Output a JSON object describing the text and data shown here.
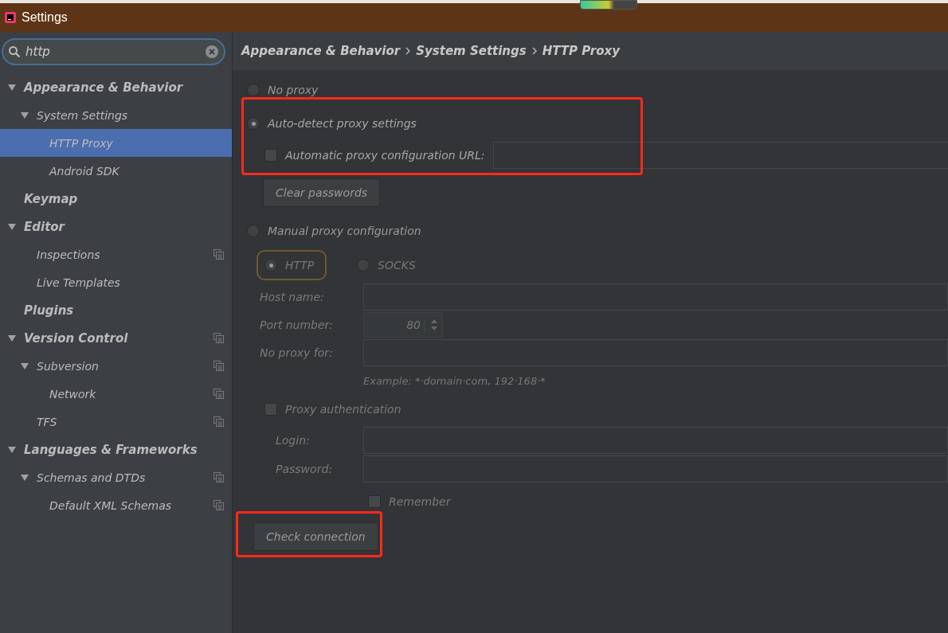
{
  "window": {
    "title": "Settings"
  },
  "search": {
    "value": "http"
  },
  "tree": [
    {
      "label": "Appearance & Behavior",
      "expanded": true,
      "selected": false,
      "project_level": false,
      "children": [
        {
          "label": "System Settings",
          "expanded": true,
          "selected": false,
          "project_level": false,
          "children": [
            {
              "label": "HTTP Proxy",
              "selected": true,
              "project_level": false
            },
            {
              "label": "Android SDK",
              "selected": false,
              "project_level": false
            }
          ]
        }
      ]
    },
    {
      "label": "Keymap",
      "selected": false,
      "project_level": false
    },
    {
      "label": "Editor",
      "expanded": true,
      "selected": false,
      "project_level": false,
      "children": [
        {
          "label": "Inspections",
          "selected": false,
          "project_level": true
        },
        {
          "label": "Live Templates",
          "selected": false,
          "project_level": false
        }
      ]
    },
    {
      "label": "Plugins",
      "selected": false,
      "project_level": false
    },
    {
      "label": "Version Control",
      "expanded": true,
      "selected": false,
      "project_level": true,
      "children": [
        {
          "label": "Subversion",
          "expanded": true,
          "selected": false,
          "project_level": true,
          "children": [
            {
              "label": "Network",
              "selected": false,
              "project_level": true
            }
          ]
        },
        {
          "label": "TFS",
          "selected": false,
          "project_level": true
        }
      ]
    },
    {
      "label": "Languages & Frameworks",
      "expanded": true,
      "selected": false,
      "project_level": false,
      "children": [
        {
          "label": "Schemas and DTDs",
          "expanded": true,
          "selected": false,
          "project_level": true,
          "children": [
            {
              "label": "Default XML Schemas",
              "selected": false,
              "project_level": true
            }
          ]
        }
      ]
    }
  ],
  "breadcrumb": [
    "Appearance & Behavior",
    "System Settings",
    "HTTP Proxy"
  ],
  "no_proxy": {
    "label": "No proxy",
    "selected": false
  },
  "auto_detect": {
    "label": "Auto-detect proxy settings",
    "selected": true,
    "pac_url": {
      "label": "Automatic proxy configuration URL:",
      "checked": false
    }
  },
  "clear_passwords": "Clear passwords",
  "manual": {
    "label": "Manual proxy configuration",
    "selected": false,
    "protocols": [
      {
        "label": "HTTP",
        "selected": true
      },
      {
        "label": "SOCKS",
        "selected": false
      }
    ],
    "host_label": "Host name:",
    "port_label": "Port number:",
    "port_value": "80",
    "no_proxy_label": "No proxy for:",
    "example": "Example: *·domain·com, 192·168·*",
    "auth": {
      "label": "Proxy authentication",
      "checked": false
    },
    "login_label": "Login:",
    "password_label": "Password:",
    "remember": {
      "label": "Remember",
      "checked": false
    }
  },
  "check_connection": "Check connection"
}
